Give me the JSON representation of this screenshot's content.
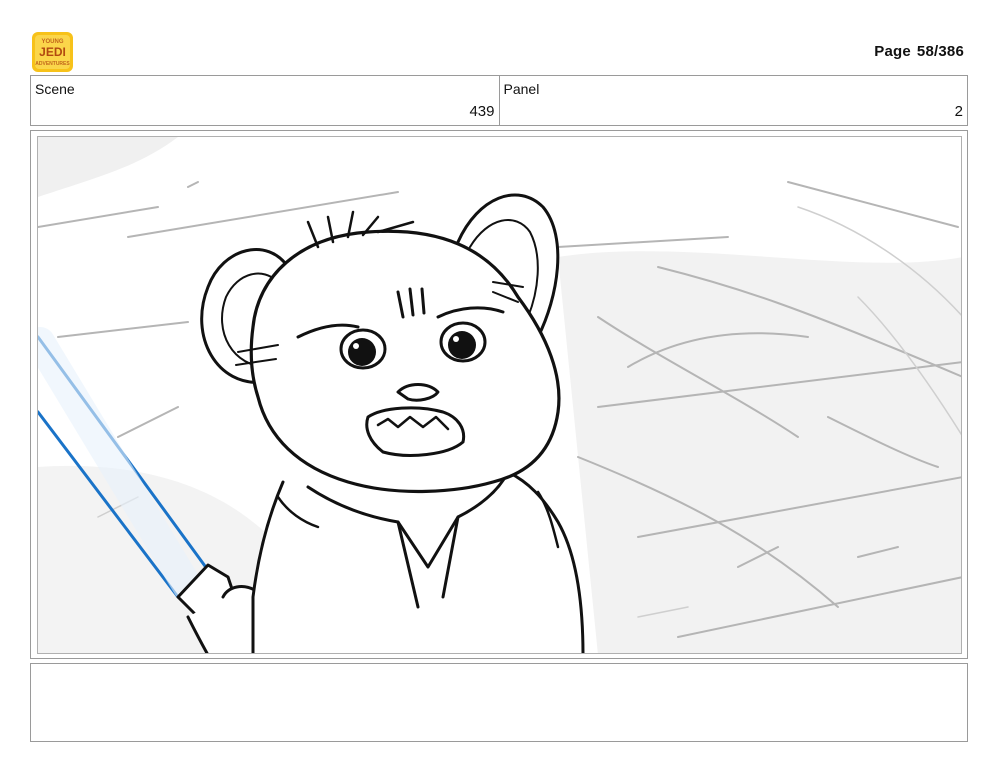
{
  "header": {
    "page_label": "Page",
    "page_number": "58/386",
    "logo_text": "YOUNG JEDI ADVENTURES"
  },
  "info": {
    "scene_label": "Scene",
    "scene_number": "439",
    "panel_label": "Panel",
    "panel_number": "2"
  },
  "panel": {
    "lightsaber_color": "#1a73c8"
  },
  "notes": {
    "text": ""
  }
}
